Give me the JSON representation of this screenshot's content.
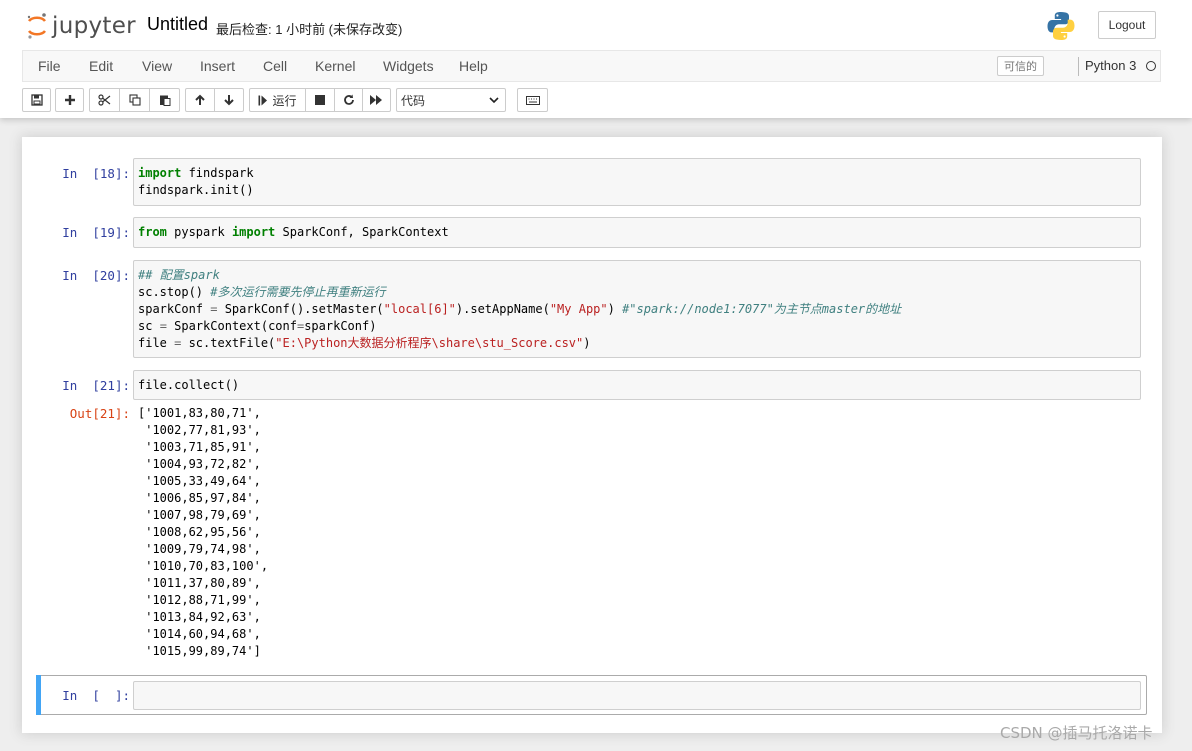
{
  "header": {
    "logo_text": "jupyter",
    "notebook_title": "Untitled",
    "checkpoint_text": "最后检查: 1 小时前  (未保存改变)",
    "logout_label": "Logout"
  },
  "menu": {
    "items": [
      "File",
      "Edit",
      "View",
      "Insert",
      "Cell",
      "Kernel",
      "Widgets",
      "Help"
    ],
    "trusted_label": "可信的",
    "kernel_name": "Python 3"
  },
  "toolbar": {
    "run_label": "运行",
    "cell_type": "代码",
    "icons": [
      "save-icon",
      "plus-icon",
      "cut-icon",
      "copy-icon",
      "paste-icon",
      "arrow-up-icon",
      "arrow-down-icon",
      "run-icon",
      "stop-icon",
      "restart-icon",
      "fast-forward-icon",
      "keyboard-icon"
    ]
  },
  "cells": [
    {
      "prompt": "In  [18]:",
      "code": [
        "import findspark",
        "findspark.init()"
      ]
    },
    {
      "prompt": "In  [19]:",
      "code": [
        "from pyspark import SparkConf, SparkContext"
      ]
    },
    {
      "prompt": "In  [20]:",
      "code": [
        "## 配置spark",
        "sc.stop() #多次运行需要先停止再重新运行",
        "sparkConf = SparkConf().setMaster(\"local[6]\").setAppName(\"My App\") #\"spark://node1:7077\"为主节点master的地址",
        "sc = SparkContext(conf=sparkConf)",
        "file = sc.textFile(\"E:\\Python大数据分析程序\\share\\stu_Score.csv\")"
      ]
    },
    {
      "prompt": "In  [21]:",
      "code": [
        "file.collect()"
      ],
      "out_prompt": "Out[21]:",
      "output": [
        "['1001,83,80,71',",
        " '1002,77,81,93',",
        " '1003,71,85,91',",
        " '1004,93,72,82',",
        " '1005,33,49,64',",
        " '1006,85,97,84',",
        " '1007,98,79,69',",
        " '1008,62,95,56',",
        " '1009,79,74,98',",
        " '1010,70,83,100',",
        " '1011,37,80,89',",
        " '1012,88,71,99',",
        " '1013,84,92,63',",
        " '1014,60,94,68',",
        " '1015,99,89,74']"
      ]
    },
    {
      "prompt": "In  [  ]:",
      "code": [
        ""
      ]
    }
  ],
  "watermark": "CSDN @插马托洛诺卡",
  "colors": {
    "prompt_in": "#303f9f",
    "prompt_out": "#d84315",
    "keyword": "#008000",
    "string": "#ba2121",
    "comment": "#408080",
    "selected_bar": "#42a5f5"
  }
}
